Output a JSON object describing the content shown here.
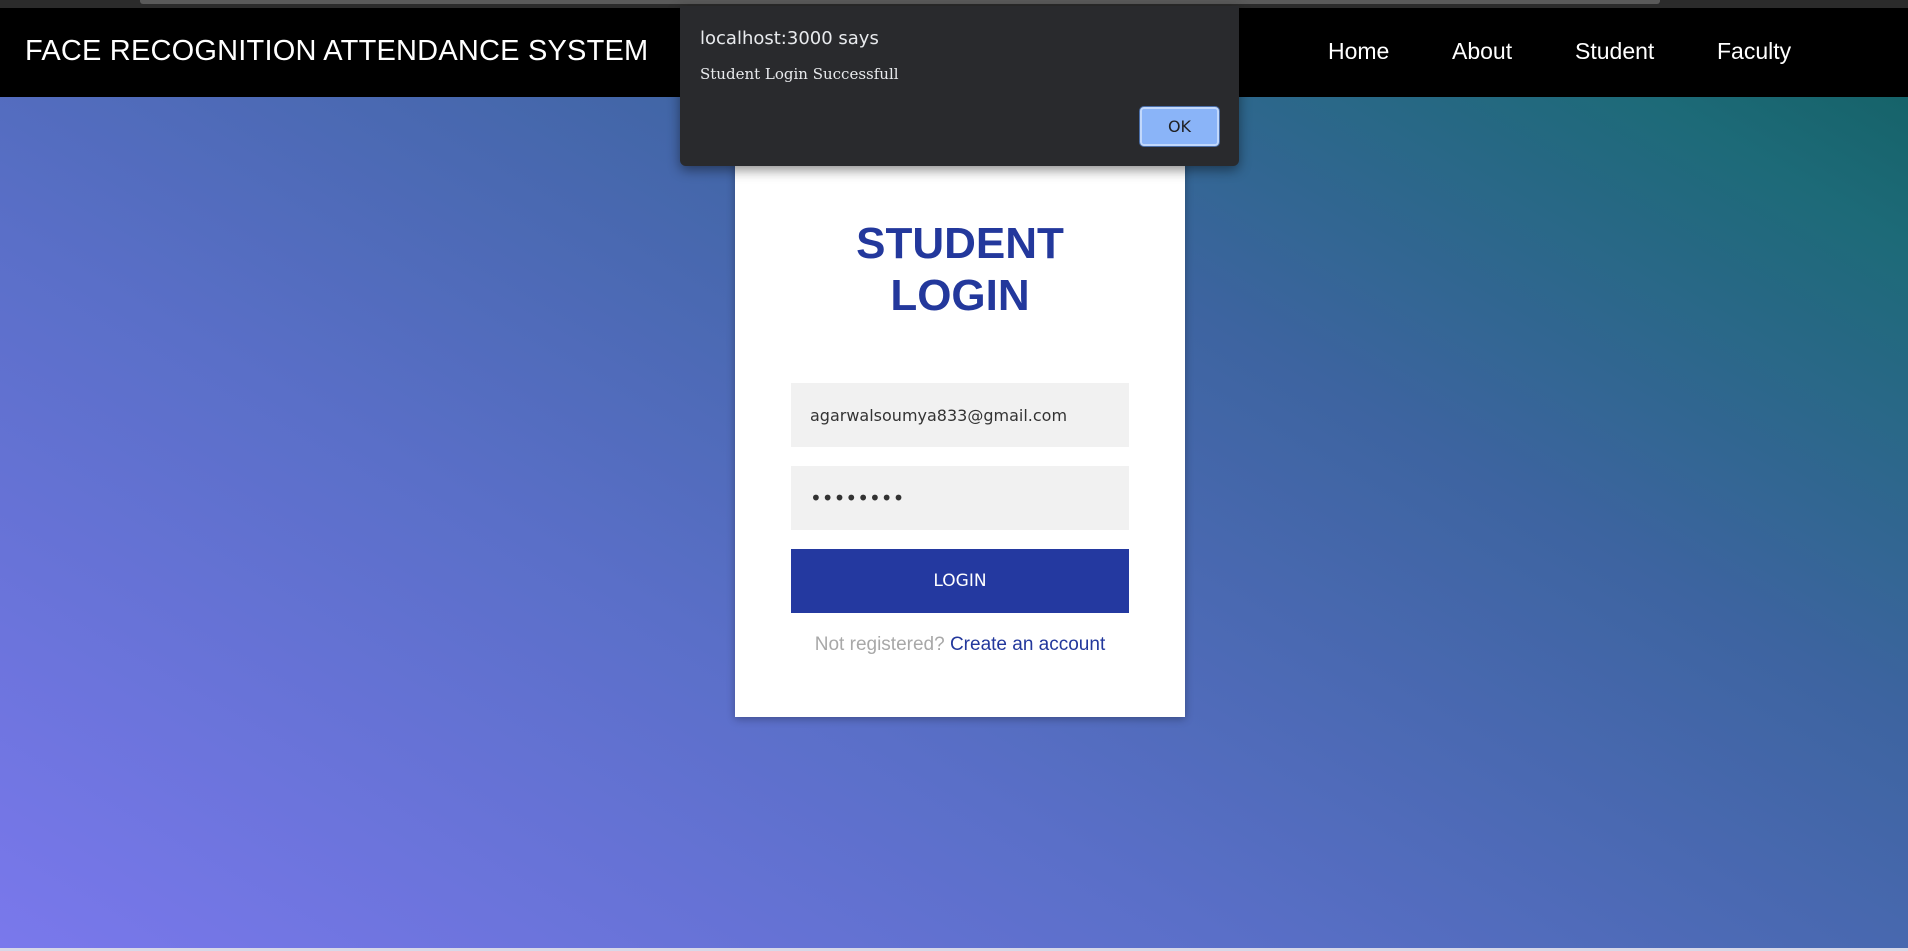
{
  "navbar": {
    "brand": "FACE RECOGNITION ATTENDANCE SYSTEM",
    "links": [
      "Home",
      "About",
      "Student",
      "Faculty"
    ]
  },
  "login_card": {
    "title_line1": "STUDENT",
    "title_line2": "LOGIN",
    "email_value": "agarwalsoumya833@gmail.com",
    "password_value": "••••••••",
    "login_button": "LOGIN",
    "register_prompt": "Not registered?",
    "register_link": "Create an account"
  },
  "alert_dialog": {
    "title": "localhost:3000 says",
    "message": "Student Login Successfull",
    "ok_button": "OK"
  },
  "colors": {
    "accent": "#2439a0",
    "navbar_bg": "#000000",
    "dialog_bg": "#292a2d",
    "ok_button": "#8ab4f8"
  }
}
